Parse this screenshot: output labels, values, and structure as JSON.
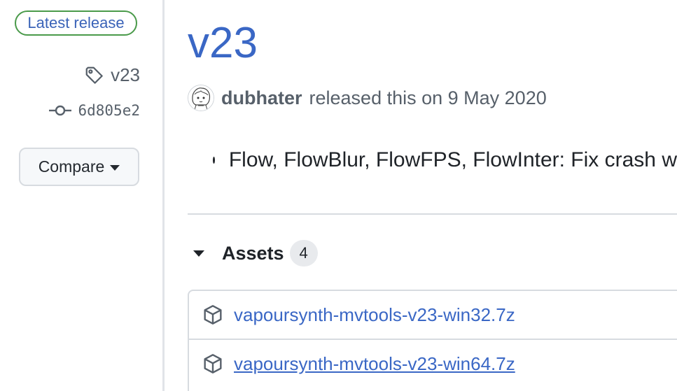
{
  "sidebar": {
    "latest_badge": "Latest release",
    "tag": "v23",
    "commit": "6d805e2",
    "compare_label": "Compare"
  },
  "release": {
    "title": "v23",
    "author": "dubhater",
    "released_text": "released this on 9 May 2020",
    "notes": [
      "Flow, FlowBlur, FlowFPS, FlowInter: Fix crash w"
    ]
  },
  "assets": {
    "label": "Assets",
    "count": "4",
    "items": [
      {
        "name": "vapoursynth-mvtools-v23-win32.7z"
      },
      {
        "name": "vapoursynth-mvtools-v23-win64.7z"
      }
    ]
  },
  "colors": {
    "link": "#3a67c5",
    "badge_border": "#4a9a4a",
    "muted": "#57606a"
  }
}
